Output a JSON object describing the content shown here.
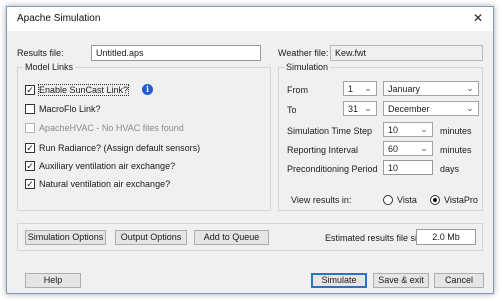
{
  "window": {
    "title": "Apache Simulation",
    "close_glyph": "✕"
  },
  "results": {
    "label": "Results file:",
    "value": "Untitled.aps"
  },
  "weather": {
    "label": "Weather file:",
    "value": "Kew.fwt"
  },
  "model_links": {
    "title": "Model Links",
    "items": [
      {
        "label": "Enable SunCast Link?",
        "checked": true,
        "enabled": true
      },
      {
        "label": "MacroFlo Link?",
        "checked": false,
        "enabled": true
      },
      {
        "label": "ApacheHVAC - No HVAC files found",
        "checked": false,
        "enabled": false
      },
      {
        "label": "Run Radiance? (Assign default sensors)",
        "checked": true,
        "enabled": true
      },
      {
        "label": "Auxiliary ventilation air exchange?",
        "checked": true,
        "enabled": true
      },
      {
        "label": "Natural ventilation air exchange?",
        "checked": true,
        "enabled": true
      }
    ],
    "info_glyph": "i"
  },
  "simulation": {
    "title": "Simulation",
    "from": {
      "label": "From",
      "day": "1",
      "month": "January"
    },
    "to": {
      "label": "To",
      "day": "31",
      "month": "December"
    },
    "time_step": {
      "label": "Simulation Time Step",
      "value": "10",
      "unit": "minutes"
    },
    "reporting": {
      "label": "Reporting Interval",
      "value": "60",
      "unit": "minutes"
    },
    "precond": {
      "label": "Preconditioning Period",
      "value": "10",
      "unit": "days"
    },
    "view_results": {
      "label": "View results in:",
      "options": [
        "Vista",
        "VistaPro"
      ],
      "selected": "VistaPro"
    }
  },
  "options_bar": {
    "sim_options": "Simulation Options",
    "output_options": "Output Options",
    "add_queue": "Add to Queue",
    "est_label": "Estimated results file size",
    "est_value": "2.0 Mb"
  },
  "footer": {
    "help": "Help",
    "simulate": "Simulate",
    "save_exit": "Save & exit",
    "cancel": "Cancel"
  },
  "icons": {
    "chevron": "⌄",
    "check": "✓"
  }
}
